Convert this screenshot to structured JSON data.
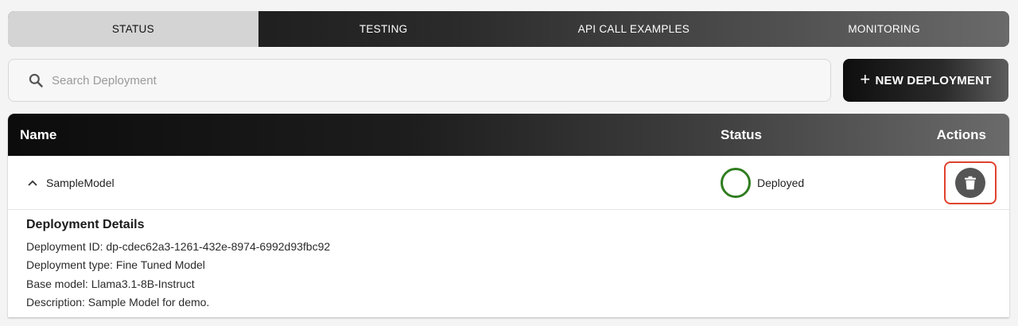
{
  "tabs": [
    {
      "label": "STATUS",
      "active": true
    },
    {
      "label": "TESTING",
      "active": false
    },
    {
      "label": "API CALL EXAMPLES",
      "active": false
    },
    {
      "label": "MONITORING",
      "active": false
    }
  ],
  "search": {
    "placeholder": "Search Deployment",
    "value": "",
    "icon": "search-icon"
  },
  "new_deployment_button": {
    "label": "NEW DEPLOYMENT",
    "icon": "plus-icon"
  },
  "table": {
    "columns": {
      "name": "Name",
      "status": "Status",
      "actions": "Actions"
    },
    "rows": [
      {
        "name": "SampleModel",
        "expanded": true,
        "status": "Deployed",
        "status_color": "#2f7d1f",
        "action_icon": "trash-icon",
        "details": {
          "title": "Deployment Details",
          "deployment_id": "Deployment ID: dp-cdec62a3-1261-432e-8974-6992d93fbc92",
          "deployment_type": "Deployment type: Fine Tuned Model",
          "base_model": "Base model: Llama3.1-8B-Instruct",
          "description": "Description: Sample Model for demo."
        }
      }
    ]
  },
  "colors": {
    "highlight_border": "#e0422e",
    "active_tab_bg": "#d4d4d4"
  }
}
